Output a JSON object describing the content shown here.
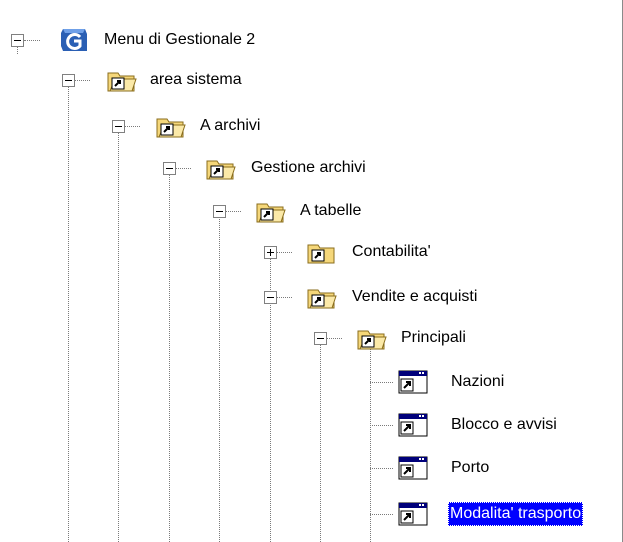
{
  "tree": {
    "root": {
      "label": "Menu di Gestionale 2",
      "icon": "gestionale-g-logo-icon",
      "expanded": true
    },
    "nodes": [
      {
        "label": "area sistema",
        "icon": "shortcut-folder-open-icon",
        "expanded": true
      },
      {
        "label": "A archivi",
        "icon": "shortcut-folder-open-icon",
        "expanded": true
      },
      {
        "label": "Gestione archivi",
        "icon": "shortcut-folder-open-icon",
        "expanded": true
      },
      {
        "label": "A tabelle",
        "icon": "shortcut-folder-open-icon",
        "expanded": true
      },
      {
        "label": "Contabilita'",
        "icon": "shortcut-folder-closed-icon",
        "expanded": false
      },
      {
        "label": "Vendite e acquisti",
        "icon": "shortcut-folder-open-icon",
        "expanded": true
      },
      {
        "label": "Principali",
        "icon": "shortcut-folder-open-icon",
        "expanded": true
      },
      {
        "label": "Nazioni",
        "icon": "program-shortcut-icon"
      },
      {
        "label": "Blocco e avvisi",
        "icon": "program-shortcut-icon"
      },
      {
        "label": "Porto",
        "icon": "program-shortcut-icon"
      },
      {
        "label": "Modalita' trasporto",
        "icon": "program-shortcut-icon",
        "selected": true
      }
    ]
  },
  "colors": {
    "selection": "#0000ff",
    "folder": "#f5d77a",
    "logo": "#2a5fb4"
  }
}
